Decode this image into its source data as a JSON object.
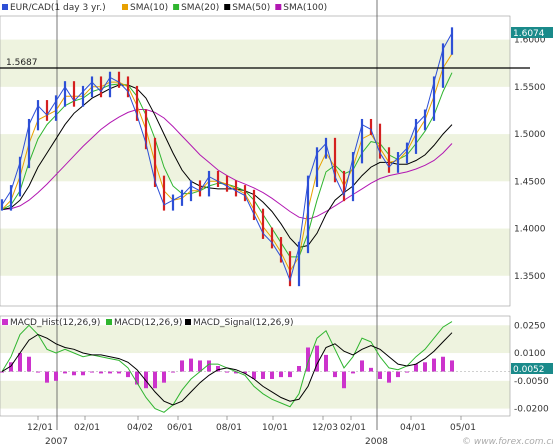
{
  "chart_data": [
    {
      "type": "line",
      "symbol": "EUR/CAD(1 day 3 yr.)",
      "legend": [
        "EUR/CAD(1 day 3 yr.)",
        "SMA(10)",
        "SMA(20)",
        "SMA(50)",
        "SMA(100)"
      ],
      "legend_colors": [
        "#2d4fd6",
        "#e8a100",
        "#2fb52f",
        "#000000",
        "#b217b2"
      ],
      "x_ticks": [
        "12/01",
        "02/01",
        "04/02",
        "06/01",
        "08/01",
        "10/01",
        "12/03",
        "02/01",
        "04/01",
        "05/01"
      ],
      "year_labels": [
        "2007",
        "2008"
      ],
      "y_ticks": [
        "1.6000",
        "1.5500",
        "1.5000",
        "1.4500",
        "1.4000",
        "1.3500"
      ],
      "ylim": [
        1.318,
        1.625
      ],
      "last_price": "1.6074",
      "reference_line": "1.5687",
      "series": [
        {
          "name": "EUR/CAD",
          "x": [
            0,
            0.02,
            0.04,
            0.06,
            0.08,
            0.1,
            0.12,
            0.14,
            0.16,
            0.18,
            0.2,
            0.22,
            0.24,
            0.26,
            0.28,
            0.3,
            0.32,
            0.34,
            0.36,
            0.38,
            0.4,
            0.42,
            0.44,
            0.46,
            0.48,
            0.5,
            0.52,
            0.54,
            0.56,
            0.58,
            0.6,
            0.62,
            0.64,
            0.66,
            0.68,
            0.7,
            0.72,
            0.74,
            0.76,
            0.78,
            0.8,
            0.82,
            0.84,
            0.86,
            0.88,
            0.9,
            0.92,
            0.94,
            0.96,
            0.98,
            1.0
          ],
          "values": [
            1.425,
            1.44,
            1.47,
            1.51,
            1.53,
            1.52,
            1.535,
            1.55,
            1.535,
            1.545,
            1.555,
            1.545,
            1.56,
            1.555,
            1.545,
            1.52,
            1.49,
            1.45,
            1.425,
            1.43,
            1.435,
            1.445,
            1.44,
            1.455,
            1.45,
            1.445,
            1.44,
            1.435,
            1.415,
            1.395,
            1.385,
            1.37,
            1.345,
            1.38,
            1.45,
            1.48,
            1.49,
            1.455,
            1.435,
            1.475,
            1.51,
            1.505,
            1.48,
            1.465,
            1.475,
            1.485,
            1.51,
            1.52,
            1.555,
            1.59,
            1.607
          ]
        },
        {
          "name": "SMA(10)",
          "values": [
            1.42,
            1.43,
            1.455,
            1.49,
            1.515,
            1.52,
            1.525,
            1.54,
            1.54,
            1.54,
            1.55,
            1.55,
            1.555,
            1.555,
            1.55,
            1.53,
            1.505,
            1.47,
            1.44,
            1.43,
            1.432,
            1.44,
            1.44,
            1.45,
            1.45,
            1.447,
            1.442,
            1.437,
            1.42,
            1.402,
            1.39,
            1.375,
            1.355,
            1.37,
            1.42,
            1.46,
            1.48,
            1.465,
            1.445,
            1.465,
            1.495,
            1.5,
            1.485,
            1.47,
            1.472,
            1.482,
            1.5,
            1.515,
            1.54,
            1.57,
            1.585
          ]
        },
        {
          "name": "SMA(20)",
          "values": [
            1.42,
            1.425,
            1.44,
            1.47,
            1.495,
            1.51,
            1.52,
            1.53,
            1.535,
            1.538,
            1.545,
            1.548,
            1.552,
            1.553,
            1.552,
            1.54,
            1.52,
            1.495,
            1.465,
            1.445,
            1.437,
            1.437,
            1.44,
            1.445,
            1.448,
            1.447,
            1.444,
            1.44,
            1.43,
            1.415,
            1.4,
            1.385,
            1.37,
            1.37,
            1.395,
            1.43,
            1.46,
            1.467,
            1.458,
            1.462,
            1.48,
            1.492,
            1.49,
            1.478,
            1.473,
            1.478,
            1.49,
            1.503,
            1.52,
            1.545,
            1.565
          ]
        },
        {
          "name": "SMA(50)",
          "values": [
            1.42,
            1.422,
            1.43,
            1.445,
            1.465,
            1.48,
            1.495,
            1.51,
            1.522,
            1.53,
            1.538,
            1.543,
            1.548,
            1.552,
            1.552,
            1.548,
            1.538,
            1.52,
            1.5,
            1.48,
            1.462,
            1.45,
            1.445,
            1.443,
            1.442,
            1.442,
            1.442,
            1.44,
            1.436,
            1.428,
            1.418,
            1.405,
            1.39,
            1.38,
            1.382,
            1.395,
            1.415,
            1.43,
            1.438,
            1.445,
            1.456,
            1.465,
            1.47,
            1.47,
            1.468,
            1.468,
            1.472,
            1.478,
            1.488,
            1.5,
            1.51
          ]
        },
        {
          "name": "SMA(100)",
          "values": [
            1.42,
            1.421,
            1.424,
            1.43,
            1.438,
            1.447,
            1.457,
            1.467,
            1.477,
            1.487,
            1.496,
            1.505,
            1.512,
            1.518,
            1.523,
            1.526,
            1.526,
            1.523,
            1.517,
            1.508,
            1.498,
            1.488,
            1.478,
            1.47,
            1.462,
            1.456,
            1.451,
            1.447,
            1.443,
            1.438,
            1.432,
            1.425,
            1.418,
            1.412,
            1.41,
            1.413,
            1.418,
            1.424,
            1.43,
            1.436,
            1.442,
            1.448,
            1.453,
            1.456,
            1.458,
            1.46,
            1.463,
            1.467,
            1.472,
            1.48,
            1.49
          ]
        }
      ]
    },
    {
      "type": "line",
      "legend": [
        "MACD_Hist(12,26,9)",
        "MACD(12,26,9)",
        "MACD_Signal(12,26,9)"
      ],
      "legend_colors": [
        "#cc33cc",
        "#2fb52f",
        "#000000"
      ],
      "y_ticks": [
        "0.0250",
        "0.0100",
        "-0.0050",
        "-0.0200"
      ],
      "ylim": [
        -0.024,
        0.03
      ],
      "last_value": "0.0052",
      "series": [
        {
          "name": "MACD",
          "values": [
            0.0,
            0.008,
            0.02,
            0.025,
            0.02,
            0.012,
            0.01,
            0.012,
            0.01,
            0.008,
            0.009,
            0.008,
            0.007,
            0.006,
            0.002,
            -0.006,
            -0.014,
            -0.02,
            -0.022,
            -0.018,
            -0.01,
            -0.004,
            0.0,
            0.004,
            0.004,
            0.002,
            0.0,
            -0.002,
            -0.008,
            -0.012,
            -0.015,
            -0.017,
            -0.019,
            -0.012,
            0.005,
            0.018,
            0.022,
            0.012,
            0.002,
            0.008,
            0.018,
            0.016,
            0.008,
            0.002,
            0.001,
            0.003,
            0.008,
            0.012,
            0.018,
            0.024,
            0.027
          ]
        },
        {
          "name": "MACD_Signal",
          "values": [
            0.0,
            0.003,
            0.01,
            0.017,
            0.02,
            0.018,
            0.015,
            0.013,
            0.012,
            0.01,
            0.009,
            0.009,
            0.008,
            0.007,
            0.005,
            0.001,
            -0.005,
            -0.011,
            -0.016,
            -0.018,
            -0.016,
            -0.011,
            -0.006,
            -0.002,
            0.001,
            0.002,
            0.001,
            -0.001,
            -0.004,
            -0.008,
            -0.011,
            -0.014,
            -0.016,
            -0.015,
            -0.008,
            0.004,
            0.013,
            0.015,
            0.011,
            0.009,
            0.012,
            0.014,
            0.012,
            0.008,
            0.004,
            0.003,
            0.004,
            0.007,
            0.011,
            0.016,
            0.021
          ]
        }
      ]
    }
  ],
  "watermark": "© www.forex.com.cn"
}
